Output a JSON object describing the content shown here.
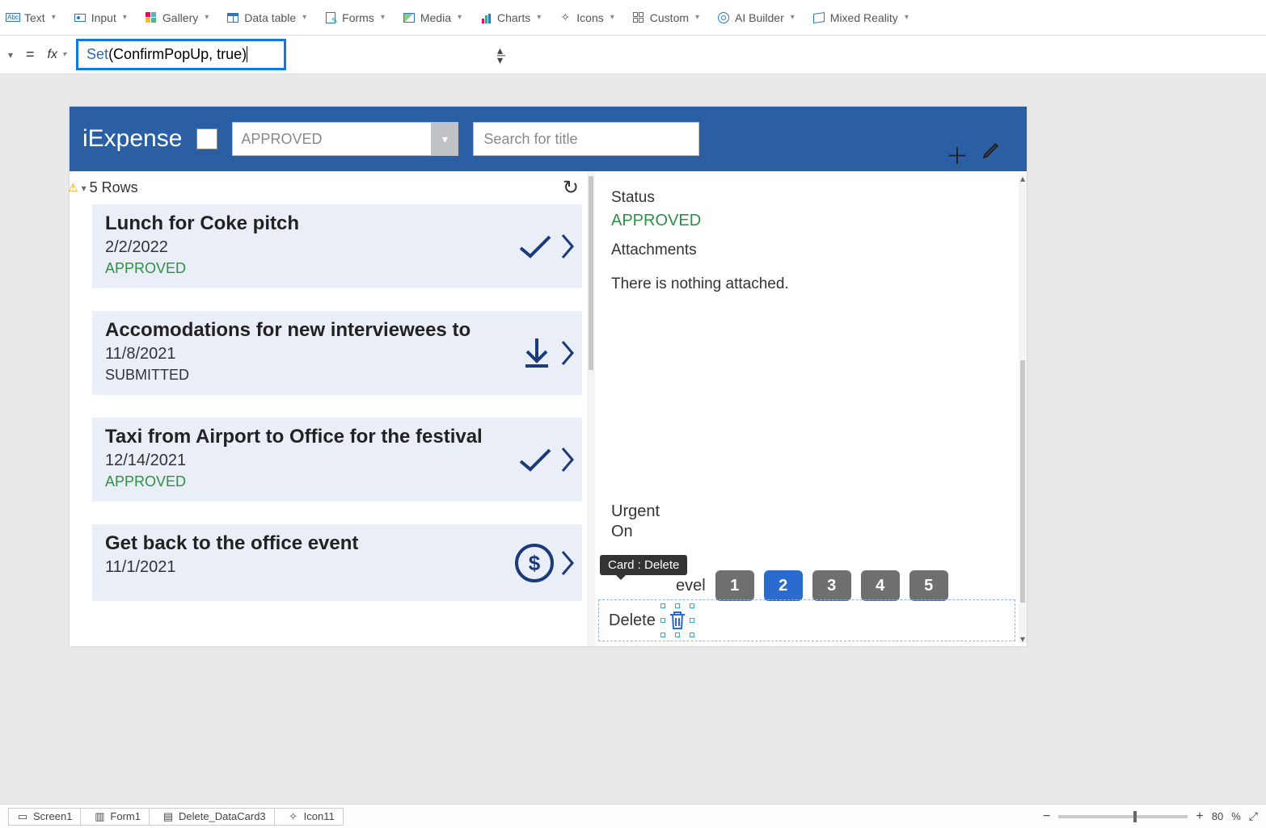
{
  "ribbon": {
    "items": [
      {
        "label": "Text"
      },
      {
        "label": "Input"
      },
      {
        "label": "Gallery"
      },
      {
        "label": "Data table"
      },
      {
        "label": "Forms"
      },
      {
        "label": "Media"
      },
      {
        "label": "Charts"
      },
      {
        "label": "Icons"
      },
      {
        "label": "Custom"
      },
      {
        "label": "AI Builder"
      },
      {
        "label": "Mixed Reality"
      }
    ]
  },
  "formula": {
    "eq": "=",
    "fx": "fx",
    "keyword": "Set",
    "args": "(ConfirmPopUp, true)"
  },
  "app": {
    "title": "iExpense",
    "filter_value": "APPROVED",
    "search_placeholder": "Search for title",
    "rows_label": "5 Rows",
    "items": [
      {
        "title": "Lunch for Coke pitch",
        "date": "2/2/2022",
        "status": "APPROVED",
        "status_class": "st-approved",
        "action": "check"
      },
      {
        "title": "Accomodations for new interviewees to",
        "date": "11/8/2021",
        "status": "SUBMITTED",
        "status_class": "st-submitted",
        "action": "download"
      },
      {
        "title": "Taxi from Airport to Office for the festival",
        "date": "12/14/2021",
        "status": "APPROVED",
        "status_class": "st-approved",
        "action": "check"
      },
      {
        "title": "Get back to the office event",
        "date": "11/1/2021",
        "status": "",
        "status_class": "",
        "action": "dollar"
      }
    ],
    "detail": {
      "status_label": "Status",
      "status_value": "APPROVED",
      "attachments_label": "Attachments",
      "attachments_empty": "There is nothing attached.",
      "urgent_label": "Urgent",
      "urgent_value": "On",
      "level_partial": "evel",
      "levels": [
        "1",
        "2",
        "3",
        "4",
        "5"
      ],
      "level_active": 2,
      "delete_label": "Delete",
      "tooltip": "Card : Delete"
    }
  },
  "breadcrumb": [
    {
      "label": "Screen1"
    },
    {
      "label": "Form1"
    },
    {
      "label": "Delete_DataCard3"
    },
    {
      "label": "Icon11"
    }
  ],
  "zoom": {
    "value": "80",
    "pct": "%"
  }
}
